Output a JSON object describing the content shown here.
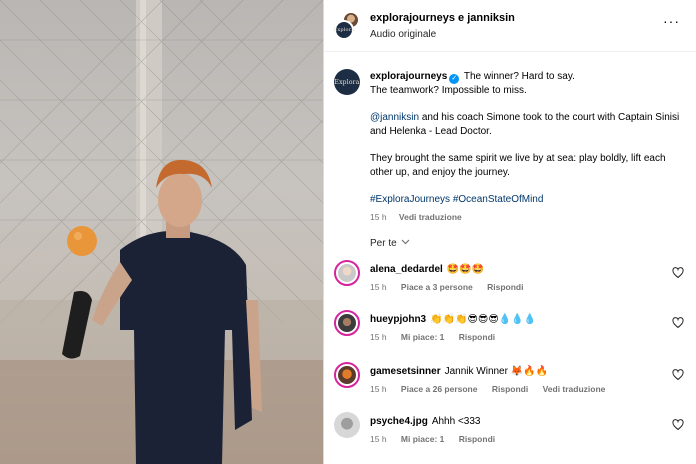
{
  "header": {
    "title": "explorajourneys e janniksin",
    "subtitle": "Audio originale",
    "more_icon": "···"
  },
  "brand": {
    "logo_text": "Explora",
    "accent": "#0095f6",
    "navy": "#1d2d44"
  },
  "post": {
    "username": "explorajourneys",
    "verified_icon": "✓",
    "line1": "The winner? Hard to say.",
    "line2": "The teamwork? Impossible to miss.",
    "mention": "@janniksin",
    "para2": " and his coach Simone took to the court with Captain Sinisi and Helenka - Lead Doctor.",
    "para3": "They brought the same spirit we live by at sea: play boldly, lift each other up, and enjoy the journey.",
    "hashtags": "#ExploraJourneys #OceanStateOfMind",
    "time": "15 h",
    "translate": "Vedi traduzione"
  },
  "per_te": "Per te",
  "per_te_icon": "chevron-down",
  "comments": [
    {
      "user": "alena_dedardel",
      "text": "🤩🤩🤩",
      "time": "15 h",
      "likes": "Piace a 3 persone",
      "reply": "Rispondi",
      "translate": ""
    },
    {
      "user": "hueypjohn3",
      "text": "👏👏👏😎😎😎💧💧💧",
      "time": "15 h",
      "likes": "Mi piace: 1",
      "reply": "Rispondi",
      "translate": ""
    },
    {
      "user": "gamesetsinner",
      "text": "Jannik Winner 🦊🔥🔥",
      "time": "15 h",
      "likes": "Piace a 26 persone",
      "reply": "Rispondi",
      "translate": "Vedi traduzione"
    },
    {
      "user": "psyche4.jpg",
      "text": "Ahhh <333",
      "time": "15 h",
      "likes": "Mi piace: 1",
      "reply": "Rispondi",
      "translate": ""
    }
  ]
}
